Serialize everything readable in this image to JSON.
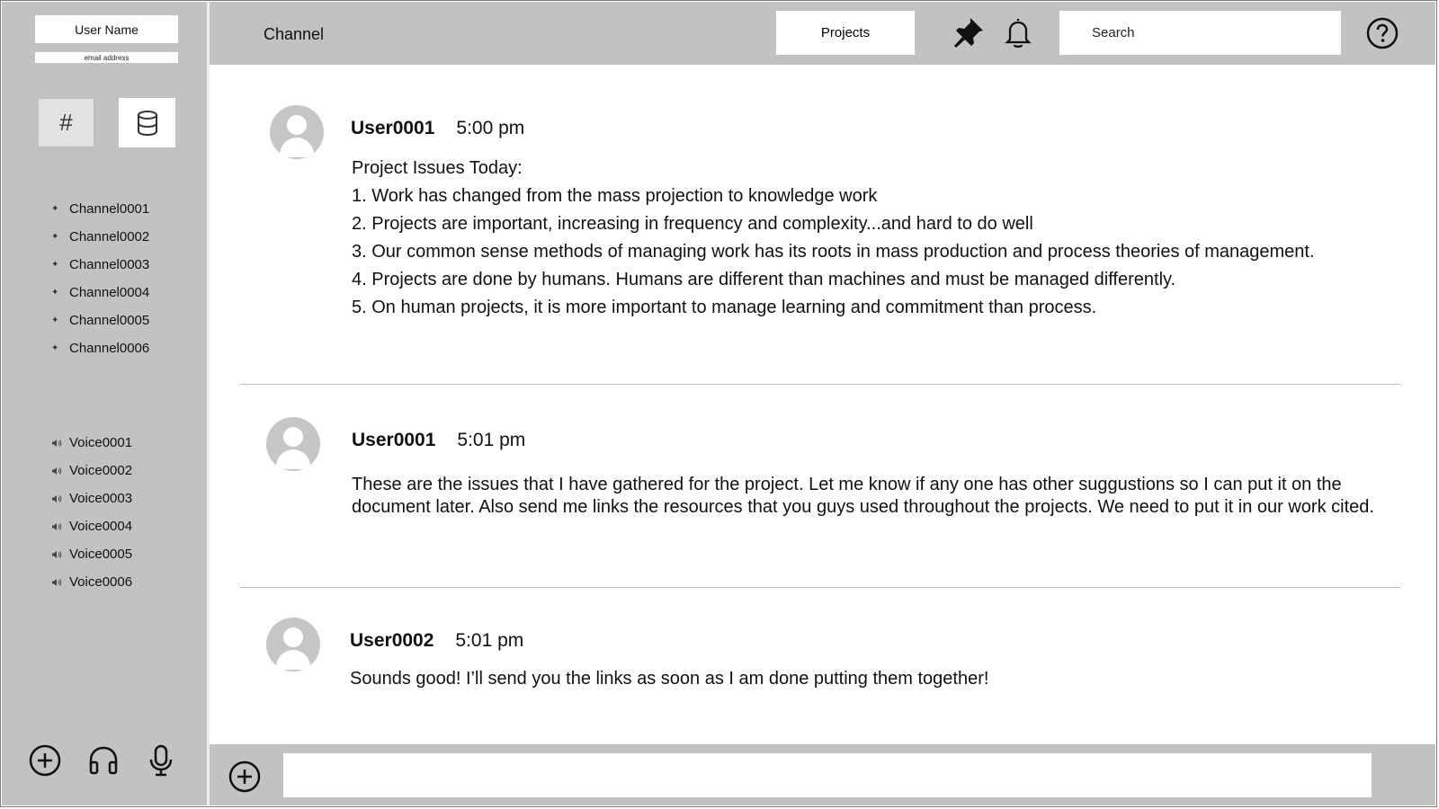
{
  "user": {
    "name": "User Name",
    "email": "email address"
  },
  "sidebar": {
    "channels": [
      "Channel0001",
      "Channel0002",
      "Channel0003",
      "Channel0004",
      "Channel0005",
      "Channel0006"
    ],
    "voices": [
      "Voice0001",
      "Voice0002",
      "Voice0003",
      "Voice0004",
      "Voice0005",
      "Voice0006"
    ],
    "hash_symbol": "#"
  },
  "header": {
    "title": "Channel",
    "projects_label": "Projects",
    "search_label": "Search"
  },
  "messages": [
    {
      "user": "User0001",
      "time": "5:00 pm",
      "lines": [
        "Project Issues Today:",
        "1. Work has changed from the mass projection to knowledge work",
        "2. Projects are important, increasing in frequency and complexity...and hard to do well",
        "3. Our common sense methods of managing work has its roots in mass production and process theories of management.",
        "4. Projects are done by humans. Humans are different than machines and must be managed differently.",
        "5. On human projects, it is more important to manage learning and commitment than process."
      ]
    },
    {
      "user": "User0001",
      "time": "5:01 pm",
      "lines": [
        "These are the issues that I have gathered for the project. Let me know if any one has other suggustions so I can put it on the document later. Also send me links the resources that you guys used throughout the projects. We need to put it in our work cited."
      ]
    },
    {
      "user": "User0002",
      "time": "5:01 pm",
      "lines": [
        "Sounds good! I’ll send you the links as soon as I am done putting them together!"
      ]
    }
  ],
  "composer": {
    "value": "",
    "placeholder": ""
  },
  "icons": {
    "sidebar_bottom": [
      "add-circle-icon",
      "headphones-icon",
      "microphone-icon"
    ],
    "header": [
      "pin-icon",
      "bell-icon",
      "help-icon"
    ],
    "footer": [
      "add-circle-icon"
    ]
  },
  "colors": {
    "panel": "#c2c2c2",
    "surface": "#ffffff",
    "avatar": "#c6c6c6",
    "divider": "#bdbdbd"
  }
}
